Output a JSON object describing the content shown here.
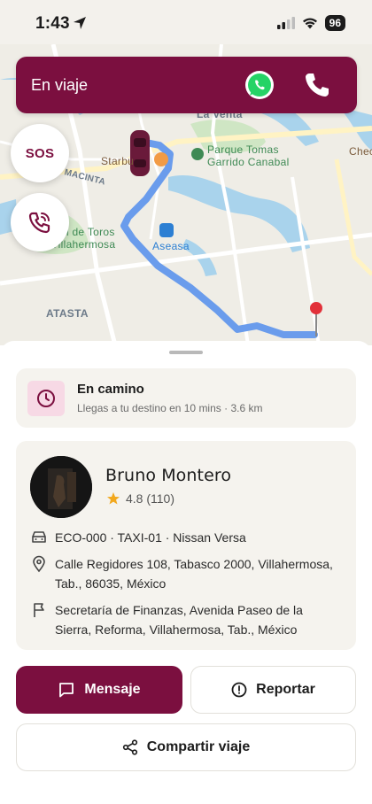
{
  "status_bar": {
    "time": "1:43",
    "battery": "96"
  },
  "map": {
    "labels": {
      "la_venta": "La Venta",
      "parque": "Parque Tomas Garrido Canabal",
      "starbucks": "Starbu",
      "macinta": "MACINTA",
      "toros": "mental de Toros de Villahermosa",
      "aseasa": "Aseasa",
      "atasta": "ATASTA",
      "chedraui": "Chec"
    }
  },
  "trip_banner": {
    "status": "En viaje"
  },
  "sos": {
    "label": "SOS"
  },
  "eta": {
    "title": "En camino",
    "subtitle": "Llegas a tu destino en 10 mins · 3.6 km"
  },
  "driver": {
    "name": "Bruno Montero",
    "rating": "4.8 (110)",
    "vehicle": "ECO-000 · TAXI-01 · Nissan Versa",
    "pickup": "Calle Regidores 108, Tabasco 2000, Villahermosa, Tab., 86035, México",
    "destination": "Secretaría de Finanzas, Avenida Paseo de la Sierra, Reforma, Villahermosa, Tab., México"
  },
  "actions": {
    "message": "Mensaje",
    "report": "Reportar",
    "share": "Compartir viaje"
  },
  "colors": {
    "brand": "#7b0f3f",
    "route": "#6a9cec",
    "card_bg": "#f5f3ee"
  }
}
